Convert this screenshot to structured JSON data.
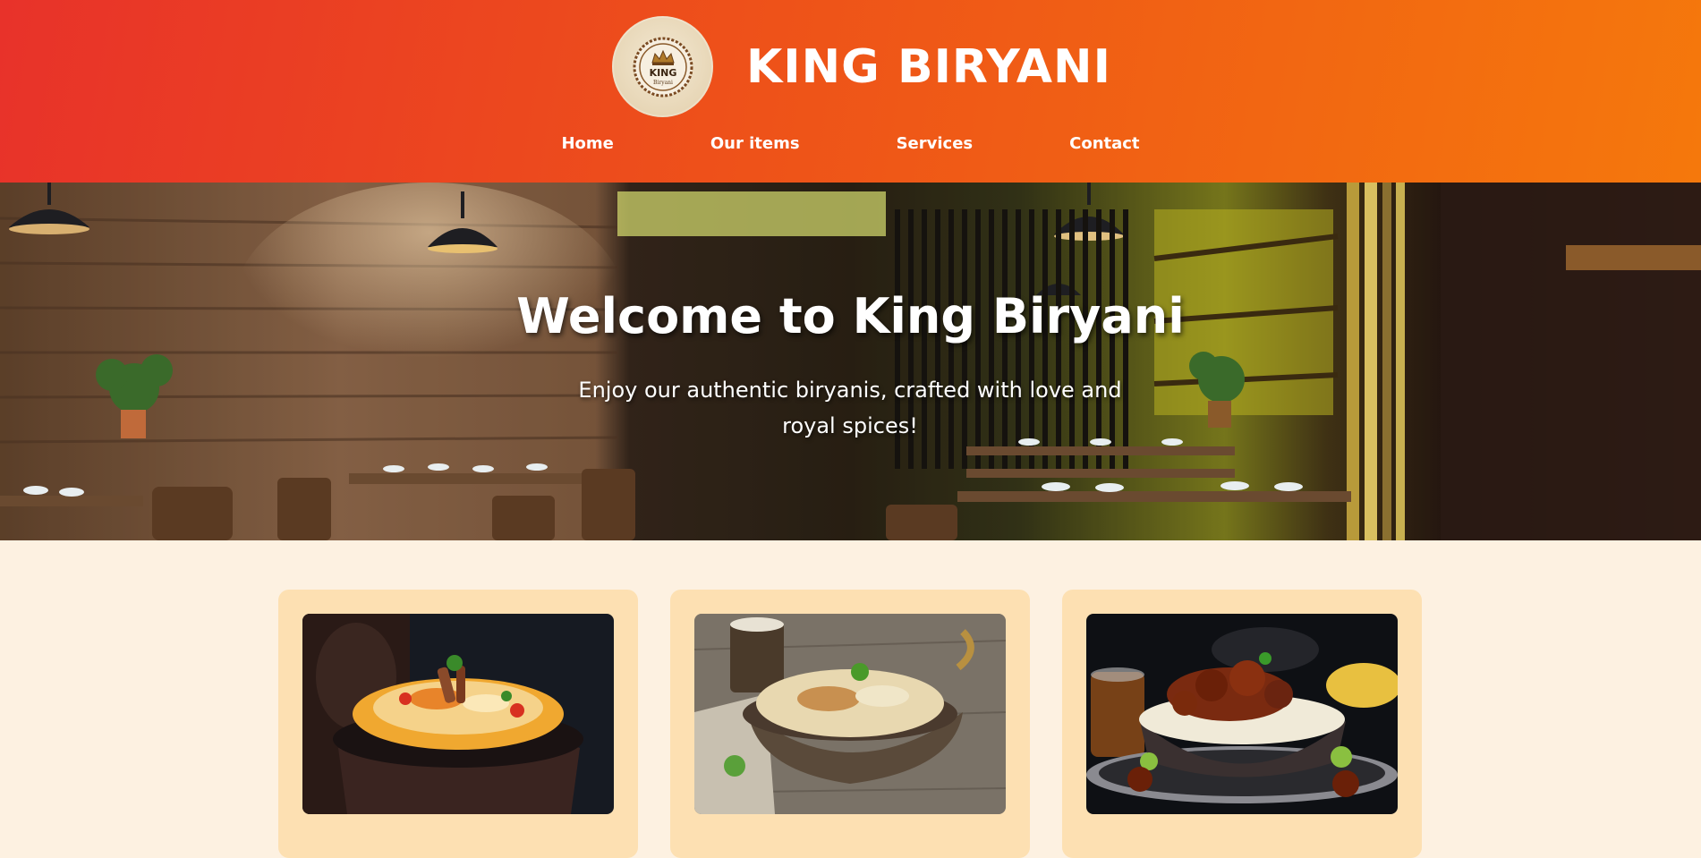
{
  "header": {
    "logo_icon": "crown-logo-icon",
    "logo_text": "KING",
    "logo_subtext": "Biryani",
    "title": "KING BIRYANI",
    "nav": [
      {
        "label": "Home"
      },
      {
        "label": "Our items"
      },
      {
        "label": "Services"
      },
      {
        "label": "Contact"
      }
    ]
  },
  "hero": {
    "title": "Welcome to King Biryani",
    "subtitle": "Enjoy our authentic biryanis, crafted with love and royal spices!"
  },
  "cards": [
    {
      "image": "biryani-in-clay-pot-image"
    },
    {
      "image": "biryani-in-brass-bowl-image"
    },
    {
      "image": "mutton-biryani-plate-image"
    }
  ],
  "colors": {
    "header_gradient_start": "#e8322a",
    "header_gradient_end": "#f5780c",
    "page_background": "#fdf1e1",
    "card_background": "#fde0b2"
  }
}
